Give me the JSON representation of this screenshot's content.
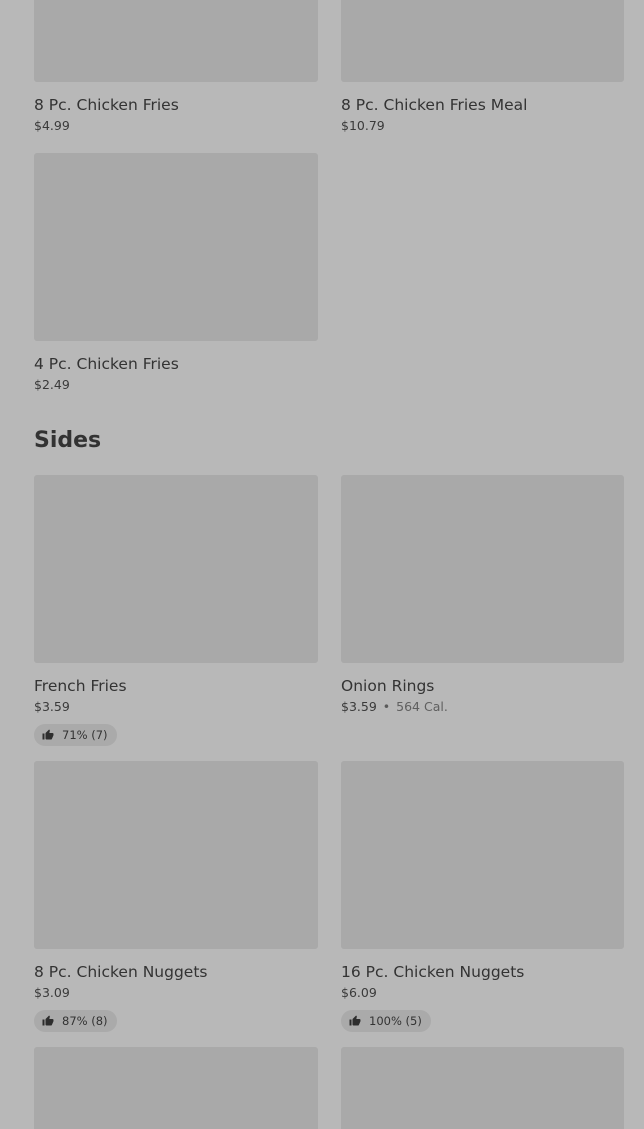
{
  "chicken_fries": [
    {
      "name": "8 Pc. Chicken Fries",
      "price": "$4.99"
    },
    {
      "name": "8 Pc. Chicken Fries Meal",
      "price": "$10.79"
    },
    {
      "name": "4 Pc. Chicken Fries",
      "price": "$2.49"
    }
  ],
  "sides": {
    "title": "Sides",
    "items": [
      {
        "name": "French Fries",
        "price": "$3.59",
        "rating": "71% (7)"
      },
      {
        "name": "Onion Rings",
        "price": "$3.59",
        "separator": "•",
        "calories": "564 Cal."
      },
      {
        "name": "8 Pc. Chicken Nuggets",
        "price": "$3.09",
        "rating": "87% (8)"
      },
      {
        "name": "16 Pc. Chicken Nuggets",
        "price": "$6.09",
        "rating": "100% (5)"
      }
    ]
  },
  "colors": {
    "background": "#b8b8b8",
    "image_placeholder": "#a9a9a9",
    "badge": "#aaaaaa",
    "text": "#333333"
  },
  "icons": {
    "rating": "thumbs-up-icon"
  }
}
